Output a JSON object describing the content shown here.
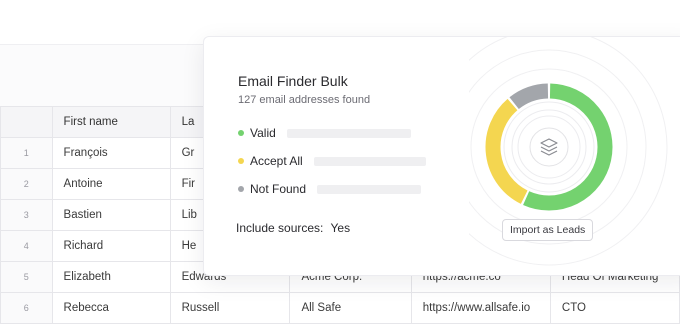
{
  "sheet": {
    "headers": [
      "First name",
      "La"
    ],
    "rows": [
      {
        "num": "1",
        "first": "François",
        "last": "Gr",
        "company": "",
        "website": "",
        "title": ""
      },
      {
        "num": "2",
        "first": "Antoine",
        "last": "Fir",
        "company": "",
        "website": "",
        "title": ""
      },
      {
        "num": "3",
        "first": "Bastien",
        "last": "Lib",
        "company": "",
        "website": "",
        "title": ""
      },
      {
        "num": "4",
        "first": "Richard",
        "last": "He",
        "company": "",
        "website": "",
        "title": ""
      },
      {
        "num": "5",
        "first": "Elizabeth",
        "last": "Edwards",
        "company": "Acme Corp.",
        "website": "https://acme.co",
        "title": "Head Of Marketing"
      },
      {
        "num": "6",
        "first": "Rebecca",
        "last": "Russell",
        "company": "All Safe",
        "website": "https://www.allsafe.io",
        "title": "CTO"
      }
    ]
  },
  "card": {
    "title": "Email Finder Bulk",
    "subtitle": "127 email addresses found",
    "legend": [
      {
        "label": "Valid",
        "color": "#74d26f"
      },
      {
        "label": "Accept All",
        "color": "#f4d650"
      },
      {
        "label": "Not Found",
        "color": "#a3a6ab"
      }
    ],
    "sources_label": "Include sources:",
    "sources_value": "Yes",
    "import_button": "Import as Leads",
    "center_icon": "layers-icon"
  },
  "chart_data": {
    "type": "pie",
    "variant": "donut",
    "slices": [
      {
        "label": "Valid",
        "value": 0.57,
        "color": "#74d26f"
      },
      {
        "label": "Accept All",
        "value": 0.32,
        "color": "#f4d650"
      },
      {
        "label": "Not Found",
        "value": 0.11,
        "color": "#a3a6ab"
      }
    ]
  }
}
